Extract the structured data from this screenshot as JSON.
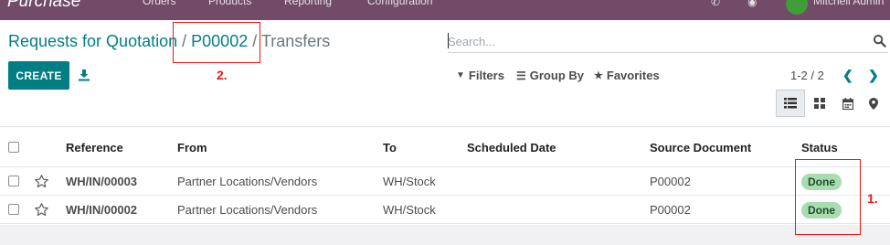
{
  "topbar": {
    "app_name": "Purchase",
    "menu_items": [
      "Orders",
      "Products",
      "Reporting",
      "Configuration"
    ],
    "user_name": "Mitchell Admin"
  },
  "breadcrumb": {
    "root": "Requests for Quotation",
    "separator": "/",
    "record": "P00002",
    "current": "Transfers"
  },
  "search": {
    "placeholder": "Search..."
  },
  "toolbar": {
    "create_label": "CREATE",
    "filters_label": "Filters",
    "groupby_label": "Group By",
    "favorites_label": "Favorites",
    "pager_value": "1-2 / 2"
  },
  "table": {
    "columns": [
      "Reference",
      "From",
      "To",
      "Scheduled Date",
      "Source Document",
      "Status"
    ],
    "rows": [
      {
        "reference": "WH/IN/00003",
        "from": "Partner Locations/Vendors",
        "to": "WH/Stock",
        "scheduled_date": "",
        "source_document": "P00002",
        "status": "Done"
      },
      {
        "reference": "WH/IN/00002",
        "from": "Partner Locations/Vendors",
        "to": "WH/Stock",
        "scheduled_date": "",
        "source_document": "P00002",
        "status": "Done"
      }
    ]
  },
  "annotations": {
    "label_1": "1.",
    "label_2": "2."
  },
  "colors": {
    "brand": "#714b67",
    "accent": "#017e84",
    "badge_success": "#a9dcb1",
    "annotation": "#e31b1b"
  }
}
